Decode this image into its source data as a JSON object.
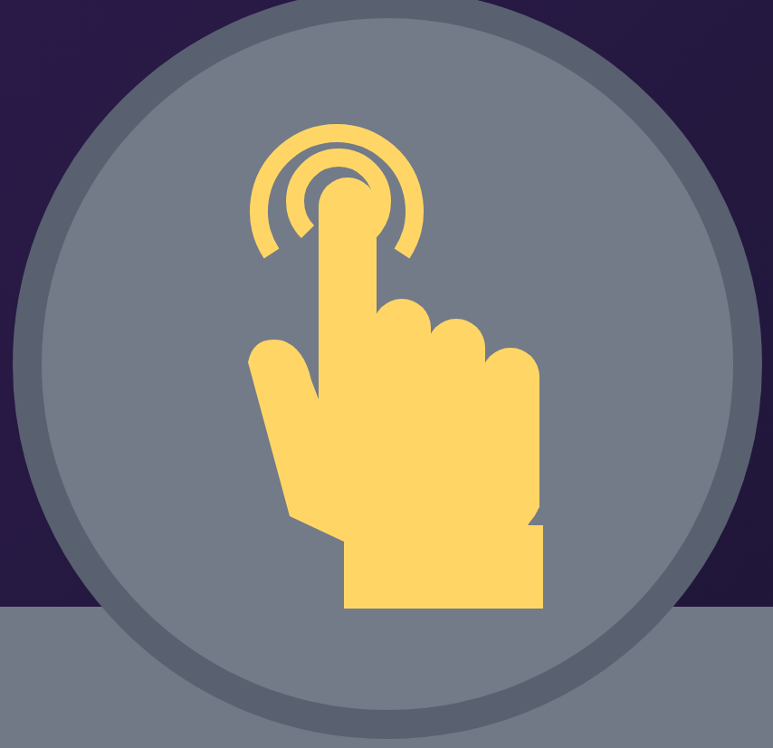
{
  "hero": {
    "kind": "icon-badge"
  }
}
